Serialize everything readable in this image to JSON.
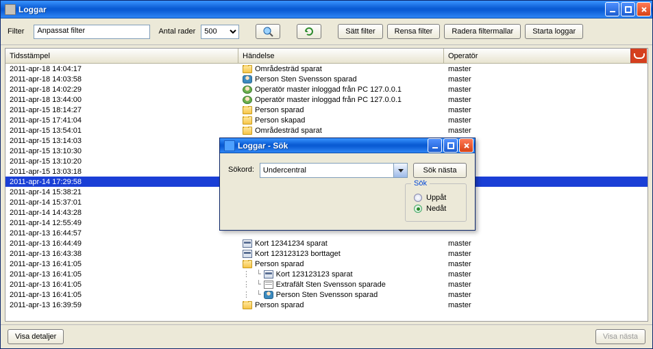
{
  "window": {
    "title": "Loggar"
  },
  "filterbar": {
    "filter_label": "Filter",
    "filter_value": "Anpassat filter",
    "rowcount_label": "Antal rader",
    "rowcount_value": "500",
    "btn_set_filter": "Sätt filter",
    "btn_clear_filter": "Rensa filter",
    "btn_delete_templates": "Radera filtermallar",
    "btn_start_logs": "Starta loggar"
  },
  "columns": {
    "timestamp": "Tidsstämpel",
    "event": "Händelse",
    "operator": "Operatör"
  },
  "rows": [
    {
      "ts": "2011-apr-18 14:04:17",
      "icon": "folder",
      "event": "Områdesträd sparat",
      "op": "master"
    },
    {
      "ts": "2011-apr-18 14:03:58",
      "icon": "person",
      "event": "Person Sten Svensson sparad",
      "op": "master"
    },
    {
      "ts": "2011-apr-18 14:02:29",
      "icon": "user",
      "event": "Operatör master inloggad från PC 127.0.0.1",
      "op": "master"
    },
    {
      "ts": "2011-apr-18 13:44:00",
      "icon": "user",
      "event": "Operatör master inloggad från PC 127.0.0.1",
      "op": "master"
    },
    {
      "ts": "2011-apr-15 18:14:27",
      "icon": "folder",
      "event": "Person sparad",
      "op": "master"
    },
    {
      "ts": "2011-apr-15 17:41:04",
      "icon": "folder",
      "event": "Person skapad",
      "op": "master"
    },
    {
      "ts": "2011-apr-15 13:54:01",
      "icon": "folder",
      "event": "Områdesträd sparat",
      "op": "master"
    },
    {
      "ts": "2011-apr-15 13:14:03",
      "icon": "",
      "event": "",
      "op": ""
    },
    {
      "ts": "2011-apr-15 13:10:30",
      "icon": "",
      "event": "",
      "op": ""
    },
    {
      "ts": "2011-apr-15 13:10:20",
      "icon": "",
      "event": "",
      "op": ""
    },
    {
      "ts": "2011-apr-15 13:03:18",
      "icon": "",
      "event": "",
      "op": ""
    },
    {
      "ts": "2011-apr-14 17:29:58",
      "icon": "",
      "event": "",
      "op": "",
      "selected": true
    },
    {
      "ts": "2011-apr-14 15:38:21",
      "icon": "",
      "event": "",
      "op": ""
    },
    {
      "ts": "2011-apr-14 15:37:01",
      "icon": "",
      "event": "",
      "op": ""
    },
    {
      "ts": "2011-apr-14 14:43:28",
      "icon": "",
      "event": "",
      "op": ""
    },
    {
      "ts": "2011-apr-14 12:55:49",
      "icon": "",
      "event": "",
      "op": ""
    },
    {
      "ts": "2011-apr-13 16:44:57",
      "icon": "",
      "event": "",
      "op": ""
    },
    {
      "ts": "2011-apr-13 16:44:49",
      "icon": "card",
      "event": "Kort 12341234 sparat",
      "op": "master"
    },
    {
      "ts": "2011-apr-13 16:43:38",
      "icon": "card",
      "event": "Kort 123123123 borttaget",
      "op": "master"
    },
    {
      "ts": "2011-apr-13 16:41:05",
      "icon": "folder",
      "event": "Person sparad",
      "op": "master",
      "expandable": true
    },
    {
      "ts": "2011-apr-13 16:41:05",
      "icon": "card",
      "event": "Kort 123123123 sparat",
      "op": "master",
      "indent": 1
    },
    {
      "ts": "2011-apr-13 16:41:05",
      "icon": "doc",
      "event": "Extrafält Sten Svensson sparade",
      "op": "master",
      "indent": 1
    },
    {
      "ts": "2011-apr-13 16:41:05",
      "icon": "person",
      "event": "Person Sten Svensson sparad",
      "op": "master",
      "indent": 1
    },
    {
      "ts": "2011-apr-13 16:39:59",
      "icon": "folder",
      "event": "Person sparad",
      "op": "master",
      "expandable": true
    }
  ],
  "footer": {
    "btn_details": "Visa detaljer",
    "btn_next": "Visa nästa"
  },
  "dialog": {
    "title": "Loggar - Sök",
    "label_keyword": "Sökord:",
    "keyword_value": "Undercentral",
    "btn_search_next": "Sök nästa",
    "group_label": "Sök",
    "radio_up": "Uppåt",
    "radio_down": "Nedåt",
    "radio_selected": "down"
  }
}
